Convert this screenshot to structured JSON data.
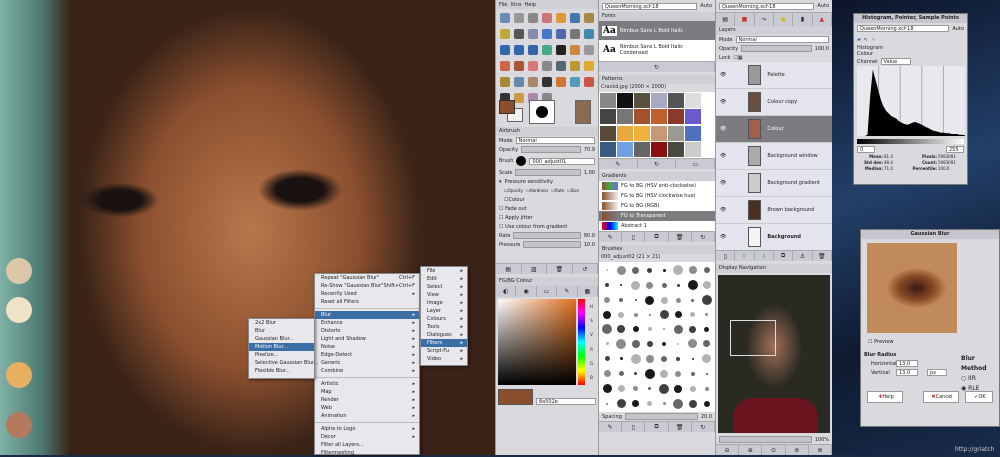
{
  "toolbox": {
    "menus": [
      "File",
      "Xtns",
      "Help"
    ]
  },
  "tool_options": {
    "title": "Airbrush",
    "mode_label": "Mode",
    "mode": "Normal",
    "opacity_label": "Opacity",
    "opacity": "70.9",
    "brush_label": "Brush",
    "brush": "000_adjust01",
    "scale_label": "Scale",
    "scale": "1.00",
    "pressure_label": "Pressure sensitivity",
    "checks": [
      "Opacity",
      "Hardness",
      "Rate",
      "Size",
      "Colour"
    ],
    "fade_out": "Fade out",
    "apply_jitter": "Apply jitter",
    "use_gradient": "Use colour from gradient",
    "rate_label": "Rate",
    "rate": "80.0",
    "pressure2_label": "Pressure",
    "pressure2": "10.0"
  },
  "fgbg": {
    "title": "FG/BG Colour",
    "hex": "8a502e",
    "fg": "#8a502e",
    "bg": "#f4f2ee",
    "channels": [
      "H",
      "S",
      "V",
      "R",
      "G",
      "B"
    ]
  },
  "image_select": "QueenMorning.xcf-18",
  "auto": "Auto",
  "fonts": {
    "title": "Fonts",
    "items": [
      "Nimbus Sans L Bold Italic",
      "Nimbus Sans L Bold Italic Condensed"
    ]
  },
  "patterns": {
    "title": "Patterns",
    "current": "Crackd.jpg (2000 × 2000)"
  },
  "gradients": {
    "title": "Gradients",
    "items": [
      "FG to BG (HSV anti-clockwise)",
      "FG to BG (HSV clockwise hue)",
      "FG to BG (RGB)",
      "FG to Transparent",
      "Abstract 1"
    ]
  },
  "brushes": {
    "title": "Brushes",
    "current": "000_adjust02 (21 × 21)",
    "spacing_label": "Spacing",
    "spacing": "20.0"
  },
  "layers": {
    "title": "Layers",
    "mode_label": "Mode",
    "mode": "Normal",
    "opacity_label": "Opacity",
    "opacity": "100.0",
    "lock_label": "Lock",
    "items": [
      "Palette",
      "Colour copy",
      "Colour",
      "Background window",
      "Background gradient",
      "Brown background",
      "Background"
    ],
    "selected": 2
  },
  "navigation": {
    "title": "Display Navigation",
    "zoom": "100%"
  },
  "menus": {
    "filters": [
      "Repeat \"Gaussian Blur\"",
      "Re-Show \"Gaussian Blur\"",
      "Recently Used",
      "Reset all Filters",
      "Blur",
      "Enhance",
      "Distorts",
      "Light and Shadow",
      "Noise",
      "Edge-Detect",
      "Generic",
      "Combine",
      "Artistic",
      "Map",
      "Render",
      "Web",
      "Animation",
      "Alpha to Logo",
      "Decor",
      "Filter all Layers...",
      "Filtermeeting"
    ],
    "shortcuts": [
      "Ctrl+F",
      "Shift+Ctrl+F"
    ],
    "blur": [
      "2x2 Blur",
      "Blur",
      "Gaussian Blur...",
      "Motion Blur...",
      "Pixelize...",
      "Selective Gaussian Blur...",
      "Flexible Blur..."
    ],
    "image": [
      "File",
      "Edit",
      "Select",
      "View",
      "Image",
      "Layer",
      "Colours",
      "Tools",
      "Dialogues",
      "Filters",
      "Script-Fu",
      "Video"
    ]
  },
  "histogram": {
    "title": "Histogram, Pointer, Sample Points",
    "section": "Histogram",
    "sub": "Colour",
    "channel_label": "Channel",
    "channel": "Value",
    "range_min": "0",
    "range_max": "255",
    "stats": [
      [
        "Mean:",
        "81.4"
      ],
      [
        "Std dev:",
        "48.4"
      ],
      [
        "Median:",
        "71.0"
      ],
      [
        "Pixels:",
        "5983091"
      ],
      [
        "Count:",
        "5983091"
      ],
      [
        "Percentile:",
        "100.0"
      ]
    ],
    "values": [
      0,
      0,
      0,
      0,
      2,
      60,
      100,
      85,
      70,
      55,
      45,
      38,
      34,
      30,
      28,
      26,
      22,
      20,
      18,
      17,
      18,
      20,
      21,
      20,
      18,
      16,
      14,
      12,
      10,
      8,
      7,
      6,
      5,
      5,
      4,
      4,
      3,
      3,
      3,
      2,
      2,
      1
    ]
  },
  "gaussian": {
    "title": "Gaussian Blur",
    "preview": "Preview",
    "radius_label": "Blur Radius",
    "horizontal_label": "Horizontal",
    "horizontal": "13.0",
    "vertical_label": "Vertical",
    "vertical": "13.0",
    "unit": "px",
    "method_label": "Blur Method",
    "methods": [
      "IIR",
      "RLE"
    ],
    "help": "Help",
    "cancel": "Cancel",
    "ok": "OK"
  },
  "watermark": "http://griatch"
}
